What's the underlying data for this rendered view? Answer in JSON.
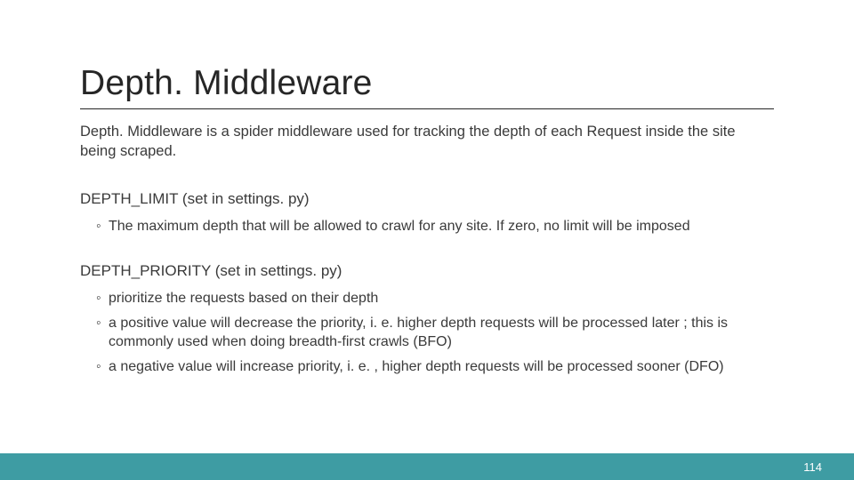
{
  "title": "Depth. Middleware",
  "intro": "Depth. Middleware is a spider middleware used for tracking the depth of each Request inside the site being scraped.",
  "sections": [
    {
      "heading": "DEPTH_LIMIT (set in settings. py)",
      "items": [
        "The maximum depth that will be allowed to crawl for any site. If zero, no limit will be imposed"
      ]
    },
    {
      "heading": "DEPTH_PRIORITY (set in settings. py)",
      "items": [
        "prioritize the requests based on their depth",
        "a positive value will decrease the priority, i. e. higher depth requests will be processed later ; this is commonly used when doing breadth-first crawls (BFO)",
        "a negative value will increase priority, i. e. , higher depth requests will be processed sooner (DFO)"
      ]
    }
  ],
  "footer": {
    "page_number": "114",
    "bar_color": "#3e9ca3"
  }
}
